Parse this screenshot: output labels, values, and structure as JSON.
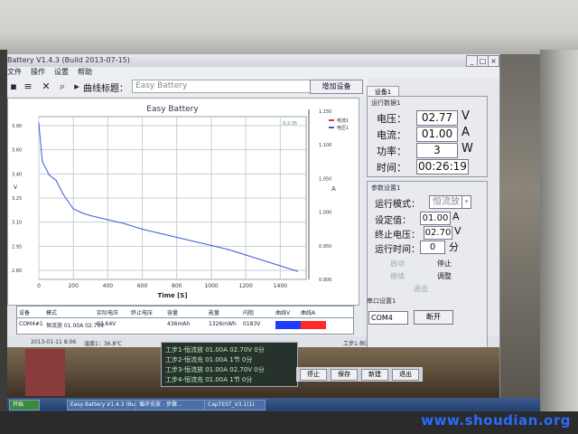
{
  "app": {
    "title": "Battery V1.4.3 (Build 2013-07-15)",
    "menu": [
      "文件",
      "操作",
      "设置",
      "帮助"
    ]
  },
  "toolbar": {
    "curve_label": "曲线标题：",
    "curve_title_value": "Easy Battery",
    "add_device_label": "增加设备"
  },
  "chart_data": {
    "type": "line",
    "title": "Easy Battery",
    "xlabel": "Time [S]",
    "corner_label": "0:2:35",
    "x_ticks": [
      0,
      200,
      400,
      600,
      800,
      1000,
      1200,
      1400
    ],
    "left_ticks": [
      "3.90",
      "3.60",
      "3.40",
      "3.25",
      "3.10",
      "2.95",
      "2.80"
    ],
    "left_axis_label": "V",
    "right_ticks": [
      "1.150",
      "1.100",
      "1.050",
      "1.000",
      "0.950",
      "0.900"
    ],
    "right_axis_label": "A",
    "legend": [
      {
        "name": "电流1",
        "color": "#d23a3a"
      },
      {
        "name": "电压1",
        "color": "#3c5bd6"
      }
    ],
    "xlim": [
      0,
      1550
    ],
    "ylim_left": [
      2.75,
      3.95
    ],
    "series": [
      {
        "name": "电压1",
        "color": "#3c5bd6",
        "x": [
          0,
          20,
          60,
          100,
          140,
          200,
          250,
          300,
          400,
          500,
          600,
          700,
          800,
          900,
          1000,
          1100,
          1200,
          1300,
          1400,
          1500
        ],
        "y": [
          3.9,
          3.62,
          3.52,
          3.48,
          3.38,
          3.27,
          3.24,
          3.22,
          3.19,
          3.16,
          3.12,
          3.09,
          3.06,
          3.03,
          3.0,
          2.97,
          2.93,
          2.89,
          2.85,
          2.81
        ]
      }
    ]
  },
  "table": {
    "headers": [
      "设备",
      "模式",
      "实际电压",
      "终止电压",
      "容量",
      "能量",
      "内阻",
      "曲线V",
      "曲线A"
    ],
    "row": [
      "COM4#1",
      "恒流放 01.00A 02.70V",
      "03.64V",
      "",
      "436mAh",
      "1326mWh",
      "0183V",
      "",
      ""
    ],
    "curve_v_color": "#1f3cff",
    "curve_a_color": "#ff2a2a"
  },
  "run_panel": {
    "tab": "设备1",
    "title": "运行数据1",
    "voltage_label": "电压：",
    "voltage": "02.77",
    "voltage_unit": "V",
    "current_label": "电流：",
    "current": "01.00",
    "current_unit": "A",
    "power_label": "功率：",
    "power": "3",
    "power_unit": "W",
    "time_label": "时间：",
    "time": "00:26:19"
  },
  "param_panel": {
    "title": "参数设置1",
    "mode_label": "运行模式：",
    "mode_value": "恒流放",
    "set_label": "设定值：",
    "set_value": "01.00",
    "set_unit": "A",
    "end_label": "终止电压：",
    "end_value": "02.70",
    "end_unit": "V",
    "runtime_label": "运行时间：",
    "runtime_value": "0",
    "runtime_unit": "分",
    "buttons": [
      "启动",
      "停止",
      "继续",
      "调整",
      "退出"
    ]
  },
  "port_panel": {
    "title": "串口设置1",
    "port_value": "COM4",
    "open_label": "断开"
  },
  "status": {
    "left": "2013-01-11 8:06",
    "mid": "温度1：36.8℃",
    "right": "工步1-恒流放 01.00A 02.70V 0S"
  },
  "log": [
    "工步1-恒流放 01.00A 02.70V 0分",
    "工步2-恒流充 01.00A 1节 0分",
    "工步3-恒流放 01.00A 02.70V 0分",
    "工步4-恒流充 01.00A 1节 0分"
  ],
  "bottom_buttons": [
    "停止",
    "保存",
    "新建",
    "退出"
  ],
  "taskbar": [
    "开始",
    "Easy Battery V1.4.3 (Build...)",
    "循环充放 - 步骤...",
    "CapTEST_V3.1(1)"
  ],
  "watermark": "www.shoudian.org"
}
